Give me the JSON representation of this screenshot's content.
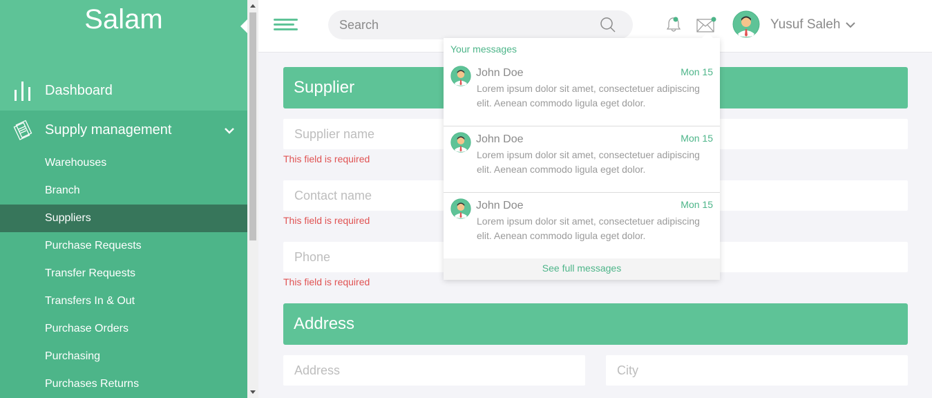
{
  "sidebar": {
    "brand": "Salam",
    "dashboard_label": "Dashboard",
    "supply_label": "Supply management",
    "items": [
      {
        "label": "Warehouses",
        "active": false
      },
      {
        "label": "Branch",
        "active": false
      },
      {
        "label": "Suppliers",
        "active": true
      },
      {
        "label": "Purchase Requests",
        "active": false
      },
      {
        "label": "Transfer Requests",
        "active": false
      },
      {
        "label": "Transfers In & Out",
        "active": false
      },
      {
        "label": "Purchase Orders",
        "active": false
      },
      {
        "label": "Purchasing",
        "active": false
      },
      {
        "label": "Purchases Returns",
        "active": false
      }
    ]
  },
  "topbar": {
    "search_placeholder": "Search",
    "user_name": "Yusuf Saleh"
  },
  "main": {
    "supplier_title": "Supplier",
    "supplier_name_placeholder": "Supplier name",
    "contact_name_placeholder": "Contact name",
    "phone_placeholder": "Phone",
    "error_text": "This field is required",
    "address_title": "Address",
    "address_placeholder": "Address",
    "city_placeholder": "City"
  },
  "messages": {
    "title": "Your messages",
    "items": [
      {
        "name": "John Doe",
        "date": "Mon 15",
        "body": "Lorem ipsum dolor sit amet, consectetuer adipiscing elit. Aenean commodo ligula eget dolor."
      },
      {
        "name": "John Doe",
        "date": "Mon 15",
        "body": "Lorem ipsum dolor sit amet, consectetuer adipiscing elit. Aenean commodo ligula eget dolor."
      },
      {
        "name": "John Doe",
        "date": "Mon 15",
        "body": "Lorem ipsum dolor sit amet, consectetuer adipiscing elit. Aenean commodo ligula eget dolor."
      }
    ],
    "footer": "See full messages"
  },
  "colors": {
    "accent": "#5ec397",
    "accent_dark": "#4db589",
    "active_item": "#37765b",
    "error": "#e05252"
  }
}
